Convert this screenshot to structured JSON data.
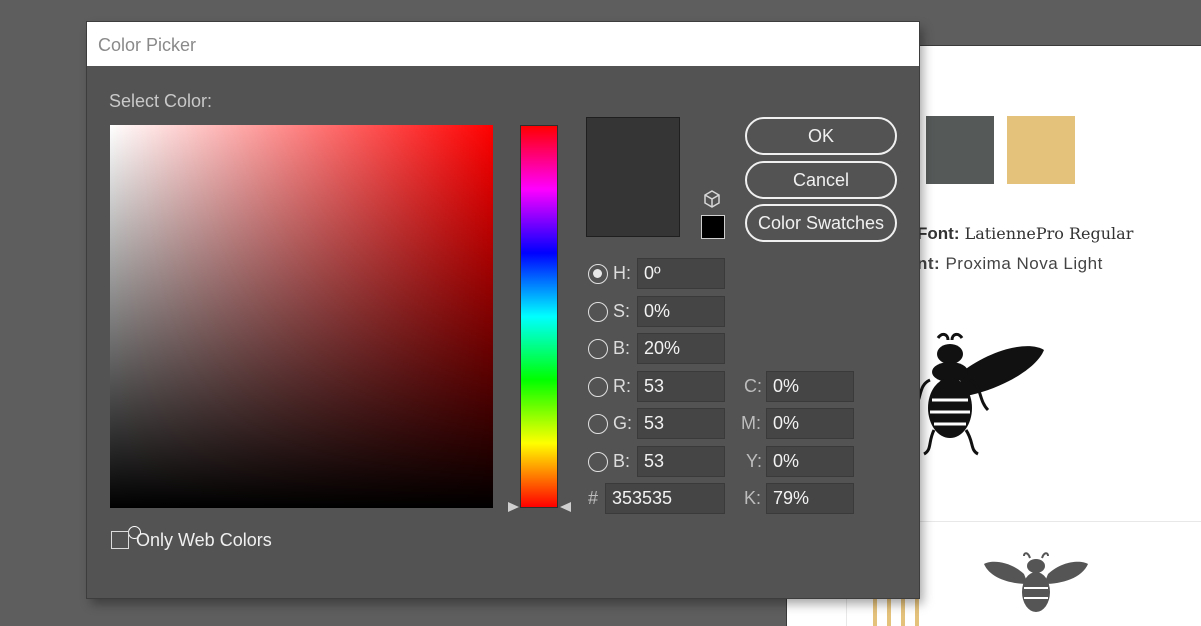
{
  "dialog": {
    "title": "Color Picker",
    "select_color_label": "Select Color:",
    "buttons": {
      "ok": "OK",
      "cancel": "Cancel",
      "color_swatches": "Color Swatches"
    },
    "current_color_hex_value": "#353535",
    "websafe_color_hex_value": "#000000",
    "fields": {
      "h": {
        "label": "H:",
        "value": "0º"
      },
      "s": {
        "label": "S:",
        "value": "0%"
      },
      "b": {
        "label": "B:",
        "value": "20%"
      },
      "r": {
        "label": "R:",
        "value": "53"
      },
      "g": {
        "label": "G:",
        "value": "53"
      },
      "blue": {
        "label": "B:",
        "value": "53"
      },
      "hex": {
        "label": "#",
        "value": "353535"
      },
      "c": {
        "label": "C:",
        "value": "0%"
      },
      "m": {
        "label": "M:",
        "value": "0%"
      },
      "y": {
        "label": "Y:",
        "value": "0%"
      },
      "k": {
        "label": "K:",
        "value": "79%"
      }
    },
    "selected_mode": "H",
    "only_web_colors": {
      "label": "Only Web Colors",
      "checked": false
    }
  },
  "document": {
    "swatches": [
      "#555a59",
      "#e4c27c"
    ],
    "font_lines": [
      {
        "label": "Font:",
        "value": "LatiennePro Regular"
      },
      {
        "label": "nt:",
        "value": "Proxima Nova Light"
      }
    ]
  },
  "colors": {
    "dialog_bg": "#535353",
    "field_bg": "#454545",
    "accent_text": "#f0f0f0"
  }
}
